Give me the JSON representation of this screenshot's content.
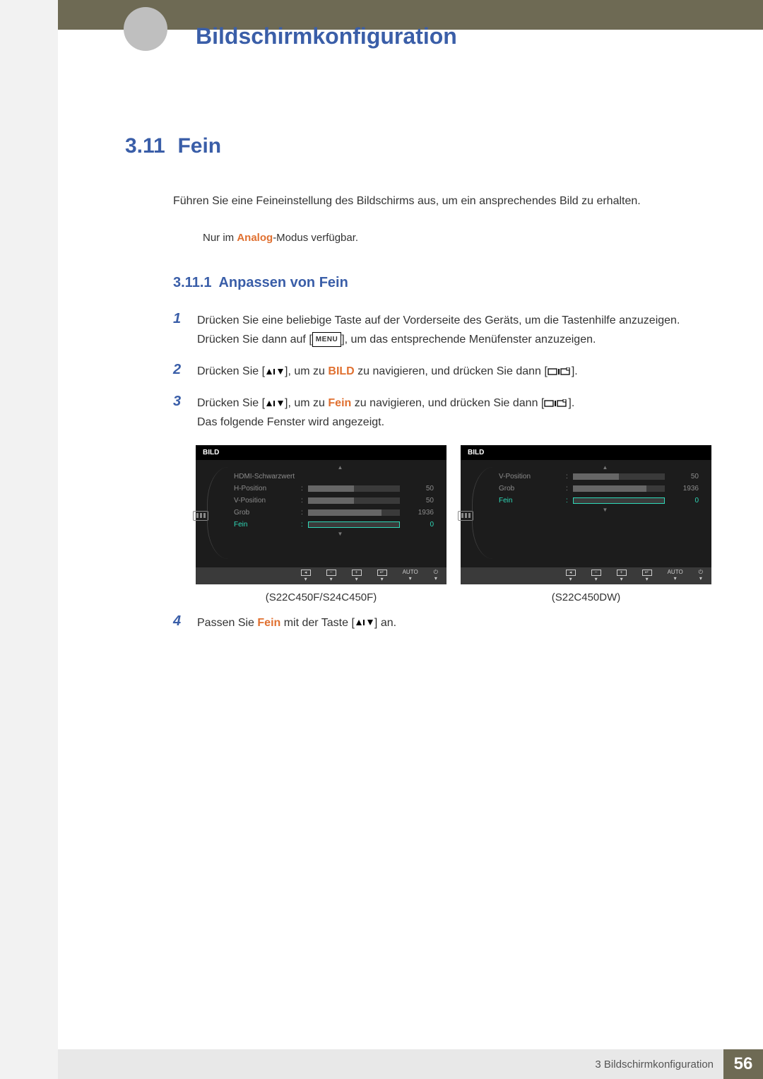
{
  "header": {
    "chapter_title": "Bildschirmkonfiguration"
  },
  "section": {
    "number": "3.11",
    "title": "Fein",
    "intro": "Führen Sie eine Feineinstellung des Bildschirms aus, um ein ansprechendes Bild zu erhalten.",
    "note_pre": "Nur im ",
    "note_highlight": "Analog",
    "note_post": "-Modus verfügbar."
  },
  "subsection": {
    "number": "3.11.1",
    "title": "Anpassen von Fein"
  },
  "steps": {
    "s1": {
      "num": "1",
      "line1": "Drücken Sie eine beliebige Taste auf der Vorderseite des Geräts, um die Tastenhilfe anzuzeigen.",
      "line2a": "Drücken Sie dann auf [",
      "menu_key": "MENU",
      "line2b": "], um das entsprechende Menüfenster anzuzeigen."
    },
    "s2": {
      "num": "2",
      "pre": "Drücken Sie [",
      "mid1": "], um zu ",
      "bold": "BILD",
      "mid2": " zu navigieren, und drücken Sie dann [",
      "post": "]."
    },
    "s3": {
      "num": "3",
      "pre": "Drücken Sie [",
      "mid1": "], um zu ",
      "bold": "Fein",
      "mid2": " zu navigieren, und drücken Sie dann [",
      "post": "].",
      "tail": "Das folgende Fenster wird angezeigt."
    },
    "s4": {
      "num": "4",
      "pre": "Passen Sie ",
      "bold": "Fein",
      "mid": " mit der Taste [",
      "post": "] an."
    }
  },
  "osd": {
    "left": {
      "title": "BILD",
      "items": [
        {
          "label": "HDMI-Schwarzwert",
          "value": "",
          "bar": false,
          "fill": 0,
          "active": false
        },
        {
          "label": "H-Position",
          "value": "50",
          "bar": true,
          "fill": 50,
          "active": false
        },
        {
          "label": "V-Position",
          "value": "50",
          "bar": true,
          "fill": 50,
          "active": false
        },
        {
          "label": "Grob",
          "value": "1936",
          "bar": true,
          "fill": 80,
          "active": false
        },
        {
          "label": "Fein",
          "value": "0",
          "bar": true,
          "fill": 0,
          "active": true
        }
      ],
      "caption": "(S22C450F/S24C450F)"
    },
    "right": {
      "title": "BILD",
      "items": [
        {
          "label": "V-Position",
          "value": "50",
          "bar": true,
          "fill": 50,
          "active": false
        },
        {
          "label": "Grob",
          "value": "1936",
          "bar": true,
          "fill": 80,
          "active": false
        },
        {
          "label": "Fein",
          "value": "0",
          "bar": true,
          "fill": 0,
          "active": true
        }
      ],
      "caption": "(S22C450DW)"
    },
    "footer_auto": "AUTO"
  },
  "footer": {
    "label": "3 Bildschirmkonfiguration",
    "page": "56"
  }
}
